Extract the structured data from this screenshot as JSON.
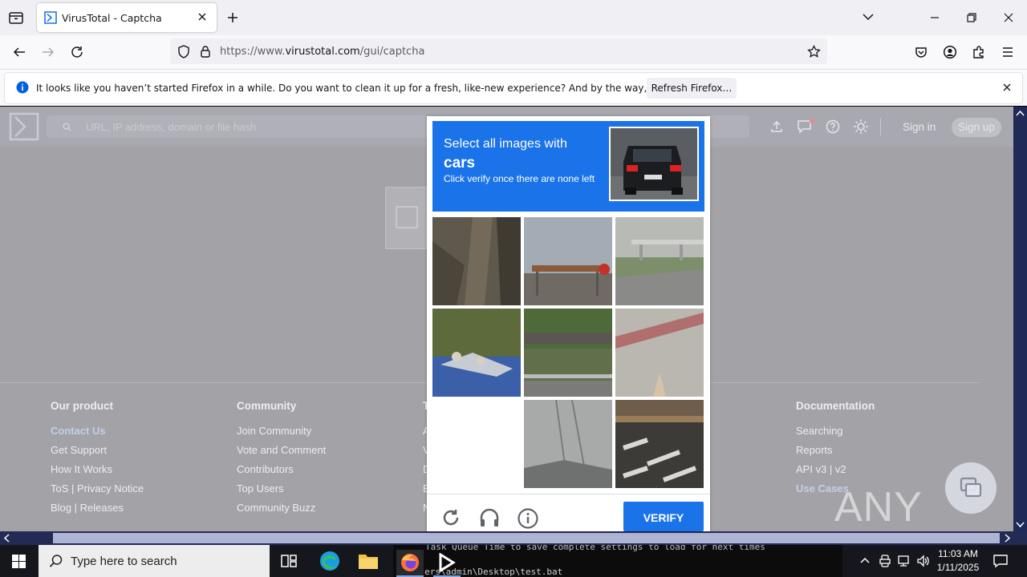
{
  "browser": {
    "tab_title": "VirusTotal - Captcha",
    "url_prefix": "https://www.",
    "url_domain": "virustotal.com",
    "url_path": "/gui/captcha"
  },
  "notification": {
    "message": "It looks like you haven’t started Firefox in a while. Do you want to clean it up for a fresh, like-new experience? And by the way, welcome back!",
    "button": "Refresh Firefox…"
  },
  "vt": {
    "search_placeholder": "URL, IP address, domain or file hash",
    "sign_in": "Sign in",
    "sign_up": "Sign up"
  },
  "footer": {
    "our_product": {
      "heading": "Our product",
      "links": [
        "Contact Us",
        "Get Support",
        "How It Works",
        "ToS | Privacy Notice",
        "Blog | Releases"
      ]
    },
    "community": {
      "heading": "Community",
      "links": [
        "Join Community",
        "Vote and Comment",
        "Contributors",
        "Top Users",
        "Community Buzz"
      ]
    },
    "documentation": {
      "heading": "Documentation",
      "links": [
        "Searching",
        "Reports",
        "API v3 | v2",
        "Use Cases"
      ]
    },
    "partial_col_heading": "T",
    "partial_col_letters": [
      "A",
      "V",
      "D",
      "E",
      "N"
    ]
  },
  "captcha": {
    "line1": "Select all images with",
    "target": "cars",
    "instruction": "Click verify once there are none left",
    "verify": "VERIFY",
    "icons": [
      "reload-icon",
      "audio-icon",
      "info-icon"
    ]
  },
  "watermark": "ANY RUN",
  "taskbar": {
    "search_placeholder": "Type here to search",
    "time": "11:03 AM",
    "date": "1/11/2025",
    "terminal_line1": "Task    Queue    Time    to save complete settings to load for next times",
    "terminal_line2": "C:\\Users\\admin\\Desktop\\test.bat"
  },
  "colors": {
    "accent": "#1a73e8",
    "overlay_gray": "#a3a3a7",
    "scrollbar": "#1f2a56"
  }
}
